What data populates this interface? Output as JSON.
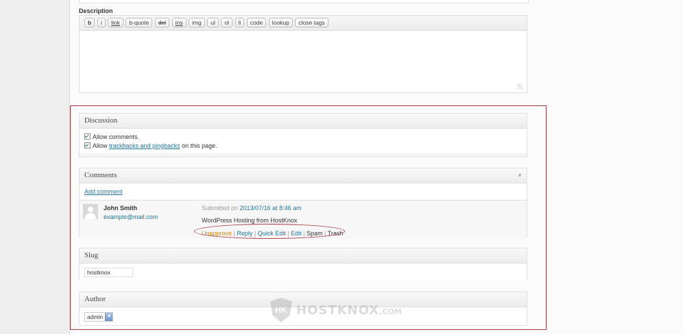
{
  "description": {
    "label": "Description",
    "toolbar": [
      "b",
      "i",
      "link",
      "b-quote",
      "del",
      "ins",
      "img",
      "ul",
      "ol",
      "li",
      "code",
      "lookup",
      "close tags"
    ]
  },
  "discussion": {
    "title": "Discussion",
    "allow_comments": "Allow comments.",
    "allow_prefix": "Allow ",
    "trackbacks_link": "trackbacks and pingbacks",
    "allow_suffix": " on this page."
  },
  "comments": {
    "title": "Comments",
    "collapse_icon": "▼",
    "add_comment": "Add comment",
    "items": [
      {
        "author": "John Smith",
        "email": "example@mail.com",
        "submitted_prefix": "Submitted on ",
        "date": "2013/07/16 at 8:46 am",
        "text": "WordPress Hosting from HostKnox",
        "actions": {
          "unapprove": "Unapprove",
          "reply": "Reply",
          "quick_edit": "Quick Edit",
          "edit": "Edit",
          "spam": "Spam",
          "trash": "Trash",
          "separator": " | "
        }
      }
    ]
  },
  "slug": {
    "title": "Slug",
    "value": "hostknox"
  },
  "author": {
    "title": "Author",
    "selected": "admin",
    "arrow": "▼"
  },
  "watermark": {
    "shield": "HK",
    "brand": "HOSTKNOX",
    "suffix": ".COM"
  },
  "colors": {
    "link": "#21759b",
    "unapprove": "#d98500",
    "highlight": "#a8393f"
  }
}
